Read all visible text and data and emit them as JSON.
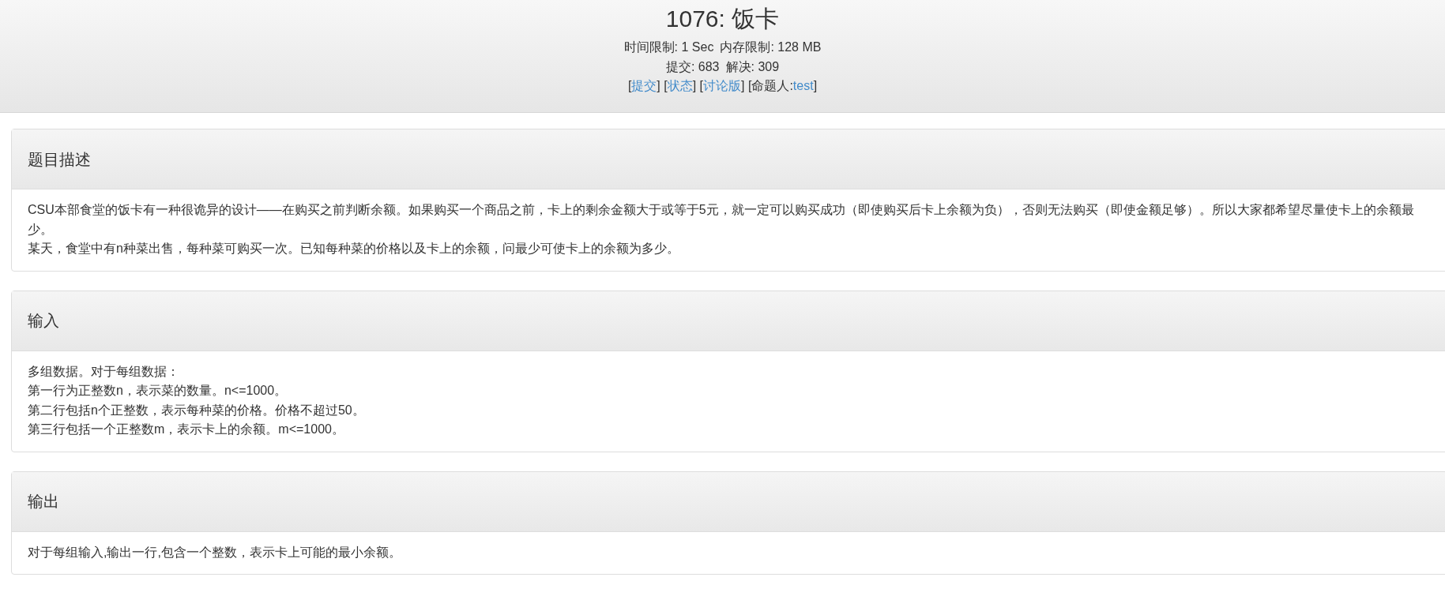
{
  "header": {
    "title": "1076: 饭卡",
    "stats": [
      [
        "时间限制: 1 Sec",
        "内存限制: 128 MB"
      ],
      [
        "提交: 683",
        "解决: 309"
      ]
    ],
    "links": [
      {
        "kind": "text",
        "text": "["
      },
      {
        "kind": "link",
        "text": "提交"
      },
      {
        "kind": "text",
        "text": "] ["
      },
      {
        "kind": "link",
        "text": "状态"
      },
      {
        "kind": "text",
        "text": "] ["
      },
      {
        "kind": "link",
        "text": "讨论版"
      },
      {
        "kind": "text",
        "text": "] [命题人:"
      },
      {
        "kind": "link",
        "text": "test"
      },
      {
        "kind": "text",
        "text": "]"
      }
    ]
  },
  "sections": [
    {
      "title": "题目描述",
      "lines": [
        "CSU本部食堂的饭卡有一种很诡异的设计——在购买之前判断余额。如果购买一个商品之前，卡上的剩余金额大于或等于5元，就一定可以购买成功（即使购买后卡上余额为负），否则无法购买（即使金额足够）。所以大家都希望尽量使卡上的余额最少。",
        "某天，食堂中有n种菜出售，每种菜可购买一次。已知每种菜的价格以及卡上的余额，问最少可使卡上的余额为多少。"
      ]
    },
    {
      "title": "输入",
      "lines": [
        "多组数据。对于每组数据：",
        "第一行为正整数n，表示菜的数量。n<=1000。",
        "第二行包括n个正整数，表示每种菜的价格。价格不超过50。",
        "第三行包括一个正整数m，表示卡上的余额。m<=1000。"
      ]
    },
    {
      "title": "输出",
      "lines": [
        "对于每组输入,输出一行,包含一个整数，表示卡上可能的最小余额。"
      ]
    }
  ]
}
